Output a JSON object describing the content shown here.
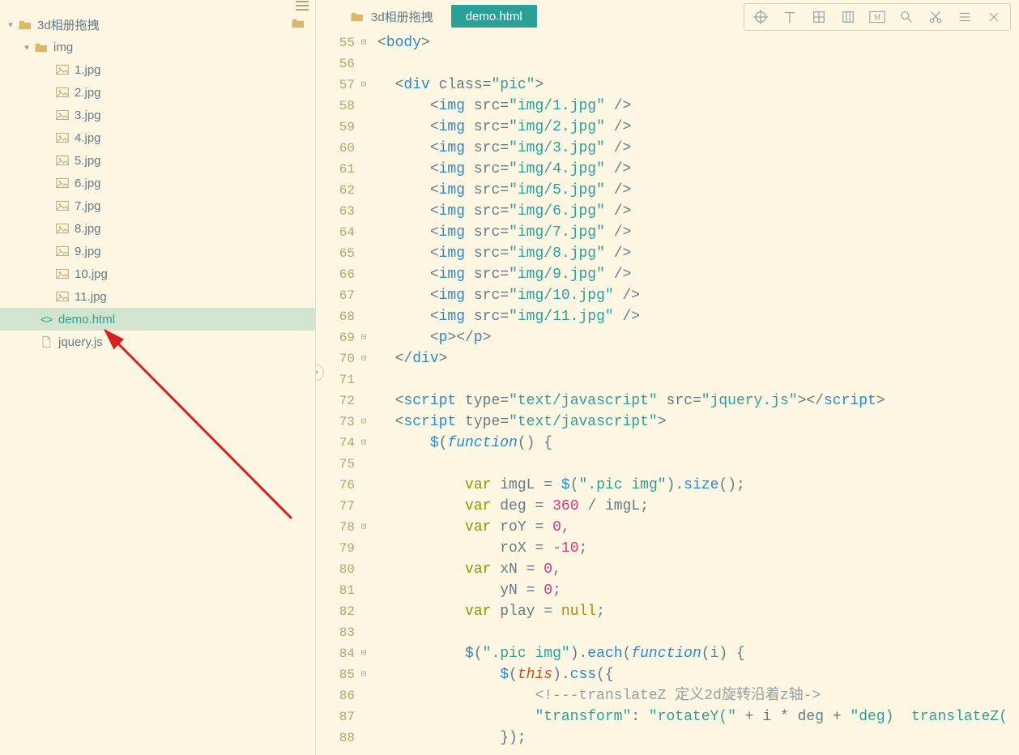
{
  "project": {
    "root_name": "3d相册拖拽",
    "folders": [
      {
        "name": "img",
        "children": [
          "1.jpg",
          "2.jpg",
          "3.jpg",
          "4.jpg",
          "5.jpg",
          "6.jpg",
          "7.jpg",
          "8.jpg",
          "9.jpg",
          "10.jpg",
          "11.jpg"
        ]
      }
    ],
    "files": [
      {
        "name": "demo.html",
        "selected": true
      },
      {
        "name": "jquery.js",
        "selected": false
      }
    ]
  },
  "tabs": {
    "folder_tab": "3d相册拖拽",
    "active_tab": "demo.html"
  },
  "gutter": {
    "start": 55,
    "end": 88,
    "fold_open": [
      55,
      57,
      70,
      73,
      74,
      78,
      84,
      85
    ],
    "fold_close": [
      69
    ]
  },
  "code_lines": [
    {
      "n": 55,
      "html": "<span class='c-punct'>&lt;</span><span class='c-tag'>body</span><span class='c-punct'>&gt;</span>"
    },
    {
      "n": 56,
      "html": ""
    },
    {
      "n": 57,
      "html": "  <span class='c-punct'>&lt;</span><span class='c-tag'>div</span> <span class='c-attr'>class</span><span class='c-punct'>=</span><span class='c-str'>\"pic\"</span><span class='c-punct'>&gt;</span>"
    },
    {
      "n": 58,
      "html": "      <span class='c-punct'>&lt;</span><span class='c-tag'>img</span> <span class='c-attr'>src</span><span class='c-punct'>=</span><span class='c-str'>\"img/1.jpg\"</span> <span class='c-punct'>/&gt;</span>"
    },
    {
      "n": 59,
      "html": "      <span class='c-punct'>&lt;</span><span class='c-tag'>img</span> <span class='c-attr'>src</span><span class='c-punct'>=</span><span class='c-str'>\"img/2.jpg\"</span> <span class='c-punct'>/&gt;</span>"
    },
    {
      "n": 60,
      "html": "      <span class='c-punct'>&lt;</span><span class='c-tag'>img</span> <span class='c-attr'>src</span><span class='c-punct'>=</span><span class='c-str'>\"img/3.jpg\"</span> <span class='c-punct'>/&gt;</span>"
    },
    {
      "n": 61,
      "html": "      <span class='c-punct'>&lt;</span><span class='c-tag'>img</span> <span class='c-attr'>src</span><span class='c-punct'>=</span><span class='c-str'>\"img/4.jpg\"</span> <span class='c-punct'>/&gt;</span>"
    },
    {
      "n": 62,
      "html": "      <span class='c-punct'>&lt;</span><span class='c-tag'>img</span> <span class='c-attr'>src</span><span class='c-punct'>=</span><span class='c-str'>\"img/5.jpg\"</span> <span class='c-punct'>/&gt;</span>"
    },
    {
      "n": 63,
      "html": "      <span class='c-punct'>&lt;</span><span class='c-tag'>img</span> <span class='c-attr'>src</span><span class='c-punct'>=</span><span class='c-str'>\"img/6.jpg\"</span> <span class='c-punct'>/&gt;</span>"
    },
    {
      "n": 64,
      "html": "      <span class='c-punct'>&lt;</span><span class='c-tag'>img</span> <span class='c-attr'>src</span><span class='c-punct'>=</span><span class='c-str'>\"img/7.jpg\"</span> <span class='c-punct'>/&gt;</span>"
    },
    {
      "n": 65,
      "html": "      <span class='c-punct'>&lt;</span><span class='c-tag'>img</span> <span class='c-attr'>src</span><span class='c-punct'>=</span><span class='c-str'>\"img/8.jpg\"</span> <span class='c-punct'>/&gt;</span>"
    },
    {
      "n": 66,
      "html": "      <span class='c-punct'>&lt;</span><span class='c-tag'>img</span> <span class='c-attr'>src</span><span class='c-punct'>=</span><span class='c-str'>\"img/9.jpg\"</span> <span class='c-punct'>/&gt;</span>"
    },
    {
      "n": 67,
      "html": "      <span class='c-punct'>&lt;</span><span class='c-tag'>img</span> <span class='c-attr'>src</span><span class='c-punct'>=</span><span class='c-str'>\"img/10.jpg\"</span> <span class='c-punct'>/&gt;</span>"
    },
    {
      "n": 68,
      "html": "      <span class='c-punct'>&lt;</span><span class='c-tag'>img</span> <span class='c-attr'>src</span><span class='c-punct'>=</span><span class='c-str'>\"img/11.jpg\"</span> <span class='c-punct'>/&gt;</span>"
    },
    {
      "n": 69,
      "html": "      <span class='c-punct'>&lt;</span><span class='c-tag'>p</span><span class='c-punct'>&gt;&lt;/</span><span class='c-tag'>p</span><span class='c-punct'>&gt;</span>"
    },
    {
      "n": 70,
      "html": "  <span class='c-punct'>&lt;/</span><span class='c-tag'>div</span><span class='c-punct'>&gt;</span>"
    },
    {
      "n": 71,
      "html": ""
    },
    {
      "n": 72,
      "html": "  <span class='c-punct'>&lt;</span><span class='c-tag'>script</span> <span class='c-attr'>type</span><span class='c-punct'>=</span><span class='c-str'>\"text/javascript\"</span> <span class='c-attr'>src</span><span class='c-punct'>=</span><span class='c-str'>\"jquery.js\"</span><span class='c-punct'>&gt;&lt;/</span><span class='c-tag'>script</span><span class='c-punct'>&gt;</span>"
    },
    {
      "n": 73,
      "html": "  <span class='c-punct'>&lt;</span><span class='c-tag'>script</span> <span class='c-attr'>type</span><span class='c-punct'>=</span><span class='c-str'>\"text/javascript\"</span><span class='c-punct'>&gt;</span>"
    },
    {
      "n": 74,
      "html": "      <span class='c-dollar'>$</span><span class='c-punct'>(</span><span class='c-func'>function</span><span class='c-punct'>() {</span>"
    },
    {
      "n": 75,
      "html": ""
    },
    {
      "n": 76,
      "html": "          <span class='c-key'>var</span> <span class='c-var'>imgL</span> <span class='c-op'>=</span> <span class='c-dollar'>$</span><span class='c-punct'>(</span><span class='c-str'>\".pic img\"</span><span class='c-punct'>).</span><span class='c-funcname'>size</span><span class='c-punct'>();</span>"
    },
    {
      "n": 77,
      "html": "          <span class='c-key'>var</span> <span class='c-var'>deg</span> <span class='c-op'>=</span> <span class='c-num'>360</span> <span class='c-op'>/</span> <span class='c-var'>imgL</span><span class='c-punct'>;</span>"
    },
    {
      "n": 78,
      "html": "          <span class='c-key'>var</span> <span class='c-var'>roY</span> <span class='c-op'>=</span> <span class='c-num'>0</span><span class='c-punct'>,</span>"
    },
    {
      "n": 79,
      "html": "              <span class='c-var'>roX</span> <span class='c-op'>=</span> <span class='c-op'>-</span><span class='c-num'>10</span><span class='c-punct'>;</span>"
    },
    {
      "n": 80,
      "html": "          <span class='c-key'>var</span> <span class='c-var'>xN</span> <span class='c-op'>=</span> <span class='c-num'>0</span><span class='c-punct'>,</span>"
    },
    {
      "n": 81,
      "html": "              <span class='c-var'>yN</span> <span class='c-op'>=</span> <span class='c-num'>0</span><span class='c-punct'>;</span>"
    },
    {
      "n": 82,
      "html": "          <span class='c-key'>var</span> <span class='c-var'>play</span> <span class='c-op'>=</span> <span class='c-const'>null</span><span class='c-punct'>;</span>"
    },
    {
      "n": 83,
      "html": ""
    },
    {
      "n": 84,
      "html": "          <span class='c-dollar'>$</span><span class='c-punct'>(</span><span class='c-str'>\".pic img\"</span><span class='c-punct'>).</span><span class='c-funcname'>each</span><span class='c-punct'>(</span><span class='c-func'>function</span><span class='c-punct'>(</span><span class='c-var'>i</span><span class='c-punct'>) {</span>"
    },
    {
      "n": 85,
      "html": "              <span class='c-dollar'>$</span><span class='c-punct'>(</span><span class='c-this'>this</span><span class='c-punct'>).</span><span class='c-funcname'>css</span><span class='c-punct'>({</span>"
    },
    {
      "n": 86,
      "html": "                  <span class='c-comment'>&lt;!---translateZ 定义2d旋转沿着z轴-&gt;</span>"
    },
    {
      "n": 87,
      "html": "                  <span class='c-str'>\"transform\"</span><span class='c-punct'>:</span> <span class='c-str'>\"rotateY(\"</span> <span class='c-op'>+</span> <span class='c-var'>i</span> <span class='c-op'>*</span> <span class='c-var'>deg</span> <span class='c-op'>+</span> <span class='c-str'>\"deg)  translateZ(</span>"
    },
    {
      "n": 88,
      "html": "              <span class='c-punct'>});</span>"
    }
  ]
}
